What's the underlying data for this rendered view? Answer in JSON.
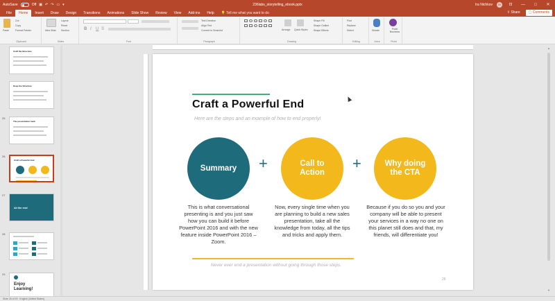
{
  "titlebar": {
    "autosave_label": "AutoSave",
    "autosave_state": "Off",
    "title": "236labs_storytelling_ebook.pptx",
    "user_name": "Ira Nichkov",
    "user_initials": "IN"
  },
  "menu": {
    "tabs": [
      "File",
      "Home",
      "Insert",
      "Draw",
      "Design",
      "Transitions",
      "Animations",
      "Slide Show",
      "Review",
      "View",
      "Add-ins",
      "Help"
    ],
    "active_index": 1,
    "tell_me": "Tell me what you want to do",
    "share": "Share",
    "comments": "Comments"
  },
  "ribbon": {
    "groups": [
      {
        "label": "Clipboard",
        "items": [
          "Paste",
          "Cut",
          "Copy",
          "Format Painter"
        ]
      },
      {
        "label": "Slides",
        "items": [
          "New Slide",
          "Layout",
          "Reset",
          "Section"
        ]
      },
      {
        "label": "Font",
        "items": []
      },
      {
        "label": "Paragraph",
        "items": [
          "Text Direction",
          "Align Text",
          "Convert to SmartArt"
        ]
      },
      {
        "label": "Drawing",
        "items": [
          "Arrange",
          "Quick Styles",
          "Shape Fill",
          "Shape Outline",
          "Shape Effects"
        ]
      },
      {
        "label": "Editing",
        "items": [
          "Find",
          "Replace",
          "Select"
        ]
      },
      {
        "label": "Voice",
        "items": [
          "Dictate"
        ]
      },
      {
        "label": "PickIt",
        "items": [
          "PickIt Business"
        ]
      }
    ]
  },
  "thumbnails": [
    {
      "number": "",
      "title": "Craft the Structure",
      "variant": "text"
    },
    {
      "number": "",
      "title": "Keep the Structure",
      "variant": "text"
    },
    {
      "number": "25",
      "title": "The presentation hack",
      "variant": "text"
    },
    {
      "number": "26",
      "title": "Craft a Powerful End",
      "variant": "circles",
      "selected": true
    },
    {
      "number": "27",
      "title": "At the end",
      "variant": "teal"
    },
    {
      "number": "28",
      "title": "",
      "variant": "numbers"
    },
    {
      "number": "29",
      "title": "Enjoy Learning!",
      "variant": "end"
    }
  ],
  "slide": {
    "title": "Craft a Powerful End",
    "subtitle": "Here are the steps and an example of how to end properly!",
    "steps": [
      {
        "label": "Summary",
        "color": "#1e6b7c",
        "description": "This is what conversational presenting is and you just saw how you can build it before PowerPoint 2016 and with the new feature inside PowerPoint 2016 – Zoom."
      },
      {
        "label": "Call to Action",
        "color": "#f2b81c",
        "description": "Now, every single time when you are planning to build a new sales presentation, take all the knowledge from today, all the tips and tricks and apply them."
      },
      {
        "label": "Why doing the CTA",
        "color": "#f2b81c",
        "description": "Because if you do so you and your company will be able to present your services in a way no one on this planet still does and that, my friends, will differentiate you!"
      }
    ],
    "plus_symbol": "+",
    "footer": "Never ever end a presentation without going through those steps.",
    "page_number": "26",
    "accent_top": "#3fae7a",
    "accent_bottom": "#f2b81c"
  },
  "statusbar": {
    "slide_info": "Slide 26 of 29",
    "language": "English (United States)"
  }
}
